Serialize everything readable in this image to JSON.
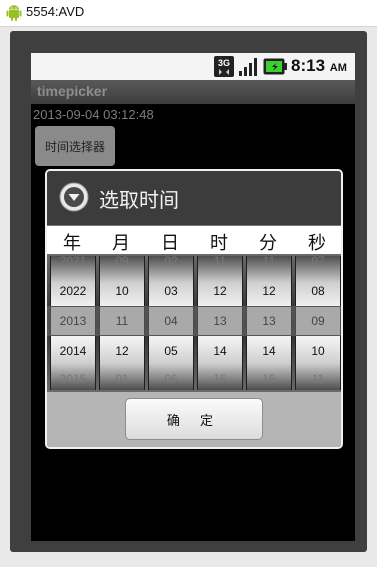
{
  "window": {
    "title": "5554:AVD"
  },
  "status_bar": {
    "network": "3G",
    "time": "8:13",
    "ampm": "AM"
  },
  "app": {
    "title": "timepicker",
    "current_datetime": "2013-09-04 03:12:48",
    "picker_button": "时间选择器"
  },
  "dialog": {
    "title": "选取时间",
    "columns": [
      {
        "label": "年",
        "values": [
          "2021",
          "2022",
          "2013",
          "2014",
          "2015"
        ]
      },
      {
        "label": "月",
        "values": [
          "09",
          "10",
          "11",
          "12",
          "01"
        ]
      },
      {
        "label": "日",
        "values": [
          "02",
          "03",
          "04",
          "05",
          "06"
        ]
      },
      {
        "label": "时",
        "values": [
          "11",
          "12",
          "13",
          "14",
          "15"
        ]
      },
      {
        "label": "分",
        "values": [
          "11",
          "12",
          "13",
          "14",
          "15"
        ]
      },
      {
        "label": "秒",
        "values": [
          "07",
          "08",
          "09",
          "10",
          "11"
        ]
      }
    ],
    "ok_button": "确 定"
  },
  "colors": {
    "accent_battery": "#3ccf2f",
    "dialog_bg": "#3a3a3a"
  },
  "icons": [
    "android-icon",
    "network-3g-icon",
    "signal-icon",
    "battery-icon",
    "dialog-chevron-icon"
  ]
}
